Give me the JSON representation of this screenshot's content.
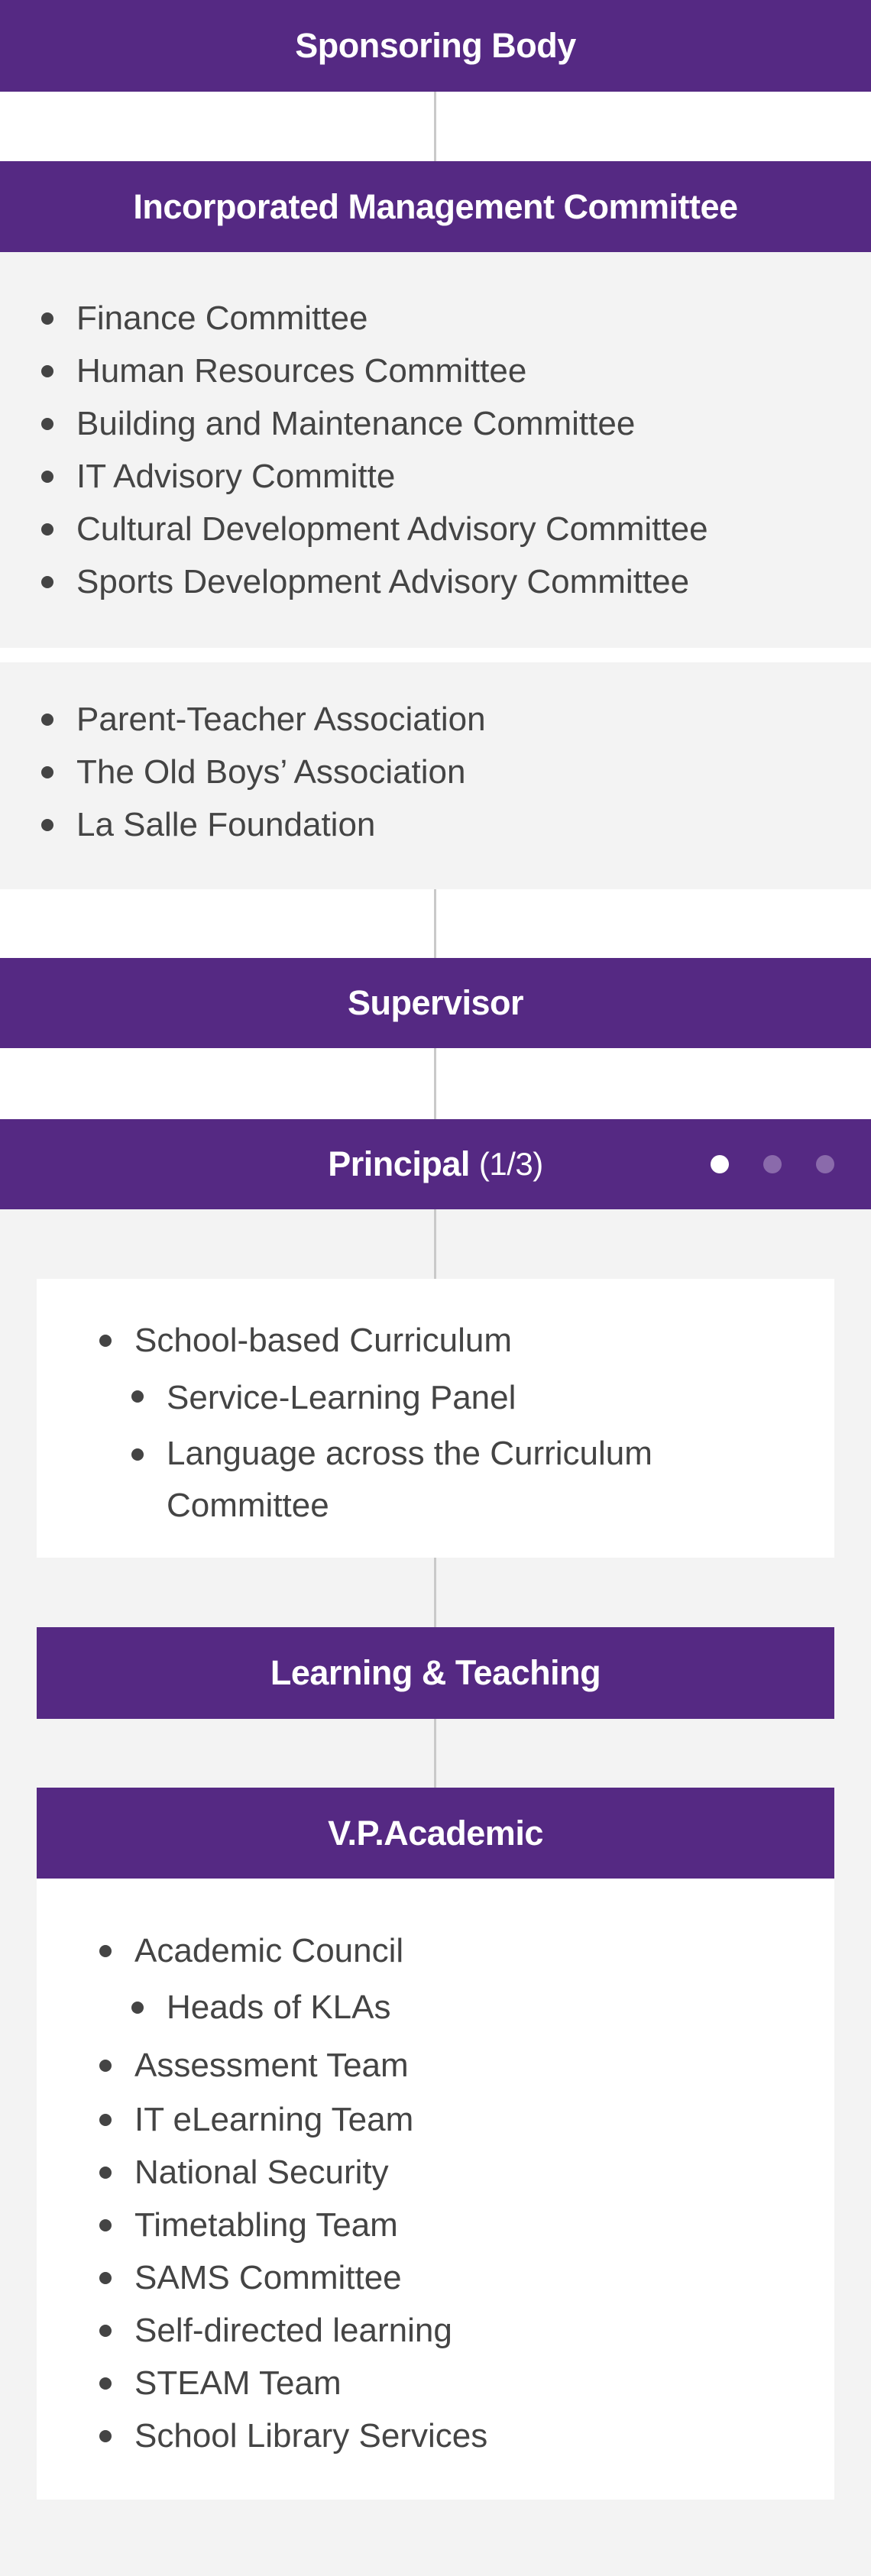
{
  "colors": {
    "brand_purple": "#552983",
    "list_text": "#444444",
    "panel_gray": "#f3f3f3",
    "connector": "#c9c9c9",
    "pager_active": "#ffffff",
    "pager_inactive": "#8a6aab"
  },
  "sponsoring_body": {
    "title": "Sponsoring Body"
  },
  "imc": {
    "title": "Incorporated Management Committee",
    "committees": [
      "Finance Committee",
      "Human Resources Committee",
      "Building and Maintenance Committee",
      "IT Advisory Committe",
      "Cultural Development Advisory Committee",
      "Sports Development Advisory Committee"
    ],
    "associations": [
      "Parent-Teacher Association",
      "The Old Boys’ Association",
      "La Salle Foundation"
    ]
  },
  "supervisor": {
    "title": "Supervisor"
  },
  "principal": {
    "title": "Principal",
    "page_indicator": "(1/3)",
    "pager": {
      "current": 1,
      "total": 3
    },
    "items": [
      {
        "label": "School-based Curriculum",
        "level": 0
      },
      {
        "label": "Service-Learning Panel",
        "level": 1
      },
      {
        "label": "Language across the Curriculum",
        "level": 1
      },
      {
        "label": "Committee",
        "level": 1,
        "continuation": true
      }
    ]
  },
  "learning_teaching": {
    "title": "Learning & Teaching"
  },
  "vp_academic": {
    "title": "V.P.Academic",
    "items": [
      {
        "label": "Academic Council",
        "level": 0
      },
      {
        "label": "Heads of KLAs",
        "level": 1
      },
      {
        "label": "Assessment Team",
        "level": 0
      },
      {
        "label": "IT eLearning Team",
        "level": 0
      },
      {
        "label": "National Security",
        "level": 0
      },
      {
        "label": "Timetabling Team",
        "level": 0
      },
      {
        "label": "SAMS Committee",
        "level": 0
      },
      {
        "label": "Self-directed learning",
        "level": 0
      },
      {
        "label": "STEAM Team",
        "level": 0
      },
      {
        "label": "School Library Services",
        "level": 0
      }
    ]
  }
}
